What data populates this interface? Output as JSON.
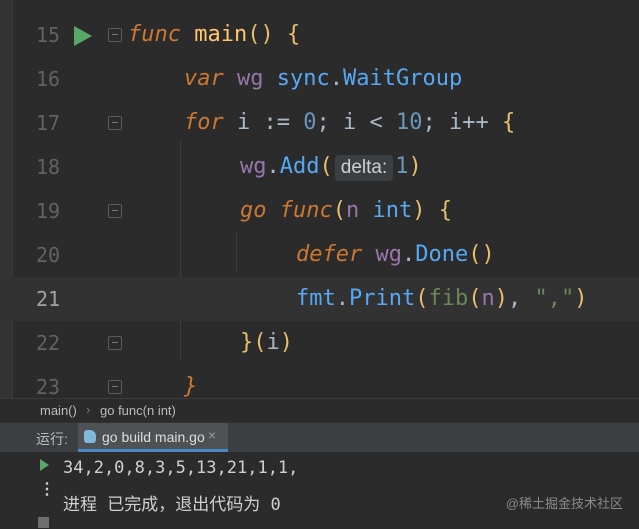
{
  "editor": {
    "lines": [
      {
        "number": "15",
        "tokens": [
          [
            "kw",
            "func"
          ],
          [
            "",
            " "
          ],
          [
            "fn",
            "main"
          ],
          [
            "br",
            "() {"
          ]
        ]
      },
      {
        "number": "16",
        "tokens": [
          [
            "kw",
            "var"
          ],
          [
            "",
            " "
          ],
          [
            "var",
            "wg"
          ],
          [
            "",
            " "
          ],
          [
            "tp",
            "sync"
          ],
          [
            "",
            "."
          ],
          [
            "tp",
            "WaitGroup"
          ]
        ]
      },
      {
        "number": "17",
        "tokens": [
          [
            "kw",
            "for"
          ],
          [
            "",
            " i := "
          ],
          [
            "num",
            "0"
          ],
          [
            "",
            "; i < "
          ],
          [
            "num",
            "10"
          ],
          [
            "",
            "; i++ "
          ],
          [
            "br",
            "{"
          ]
        ]
      },
      {
        "number": "18",
        "tokens": [
          [
            "var",
            "wg"
          ],
          [
            "",
            "."
          ],
          [
            "tp",
            "Add"
          ],
          [
            "br",
            "("
          ]
        ]
      },
      {
        "number": "19",
        "tokens": [
          [
            "kw",
            "go"
          ],
          [
            "",
            " "
          ],
          [
            "kw",
            "func"
          ],
          [
            "br",
            "("
          ],
          [
            "var",
            "n"
          ],
          [
            "",
            " "
          ],
          [
            "tp",
            "int"
          ],
          [
            "br",
            ")"
          ],
          [
            "",
            " "
          ],
          [
            "br",
            "{"
          ]
        ]
      },
      {
        "number": "20",
        "tokens": [
          [
            "kw",
            "defer"
          ],
          [
            "",
            " "
          ],
          [
            "var",
            "wg"
          ],
          [
            "",
            "."
          ],
          [
            "tp",
            "Done"
          ],
          [
            "br",
            "()"
          ]
        ]
      },
      {
        "number": "21",
        "tokens": [
          [
            "tp",
            "fmt"
          ],
          [
            "",
            "."
          ],
          [
            "tp",
            "Print"
          ],
          [
            "br",
            "("
          ],
          [
            "str",
            "fib"
          ],
          [
            "br",
            "("
          ],
          [
            "var",
            "n"
          ],
          [
            "br",
            ")"
          ],
          [
            "",
            ", "
          ],
          [
            "str",
            "\",\""
          ],
          [
            "br",
            ")"
          ]
        ]
      },
      {
        "number": "22",
        "tokens": [
          [
            "br",
            "}"
          ],
          [
            "br",
            "("
          ],
          [
            "",
            "i"
          ],
          [
            "br",
            ")"
          ]
        ]
      },
      {
        "number": "23",
        "tokens": [
          [
            "kw",
            "}"
          ]
        ]
      }
    ],
    "param_hint": {
      "name": "delta:",
      "value": "1",
      "close": ")"
    }
  },
  "breadcrumb": {
    "items": [
      "main()",
      "go func(n int)"
    ],
    "separator": "›"
  },
  "run_panel": {
    "label": "运行:",
    "tab_label": "go build main.go",
    "close_glyph": "×",
    "output": [
      "34,2,0,8,3,5,13,21,1,1,",
      "进程 已完成，退出代码为 0"
    ],
    "watermark": "@稀土掘金技术社区",
    "more_glyph": "⋮"
  },
  "colors": {
    "background": "#2b2b2b",
    "keyword": "#cc7832",
    "function": "#ffc66d",
    "string": "#6a8759",
    "number": "#6897bb",
    "run_green": "#59a869",
    "tab_underline": "#4a88c7"
  }
}
